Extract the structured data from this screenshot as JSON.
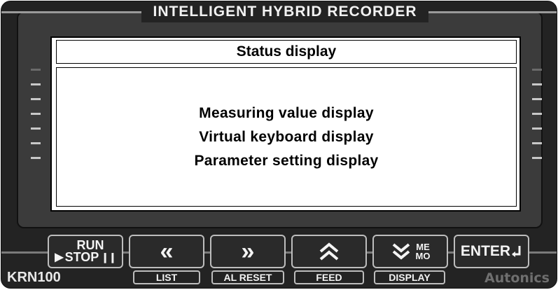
{
  "device": {
    "title": "INTELLIGENT HYBRID RECORDER",
    "model": "KRN100",
    "brand": "Autonics"
  },
  "screen": {
    "header": "Status display",
    "lines": [
      "Measuring value display",
      "Virtual keyboard display",
      "Parameter setting display"
    ]
  },
  "buttons": {
    "run_stop": {
      "run": "RUN",
      "stop": "STOP",
      "icon_play": "play-triangle",
      "icon_pause": "pause-bars"
    },
    "left": {
      "glyph": "«",
      "label": "LIST"
    },
    "right": {
      "glyph": "»",
      "label": "AL RESET"
    },
    "up": {
      "glyph": "⌃",
      "label": "FEED"
    },
    "down": {
      "glyph": "⌄",
      "memo_top": "ME",
      "memo_bottom": "MO",
      "label": "DISPLAY"
    },
    "enter": {
      "text": "ENTER",
      "icon": "return-arrow"
    }
  }
}
